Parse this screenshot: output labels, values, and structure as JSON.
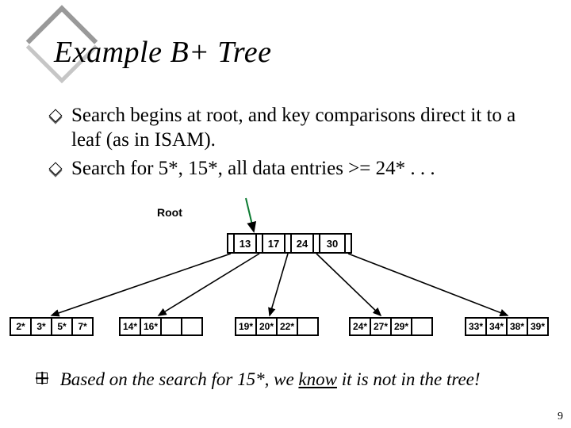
{
  "title": "Example B+ Tree",
  "bullets": [
    "Search begins at root, and key comparisons direct it to a leaf (as in ISAM).",
    "Search for 5*, 15*, all data entries >= 24* . . ."
  ],
  "tree": {
    "root_label": "Root",
    "root_keys": [
      "13",
      "17",
      "24",
      "30"
    ],
    "leaves": [
      [
        "2*",
        "3*",
        "5*",
        "7*"
      ],
      [
        "14*",
        "16*"
      ],
      [
        "19*",
        "20*",
        "22*"
      ],
      [
        "24*",
        "27*",
        "29*"
      ],
      [
        "33*",
        "34*",
        "38*",
        "39*"
      ]
    ]
  },
  "footnote": {
    "prefix": "Based on the search for 15*, we ",
    "underlined": "know",
    "suffix": " it is not in the tree!"
  },
  "page_number": "9"
}
